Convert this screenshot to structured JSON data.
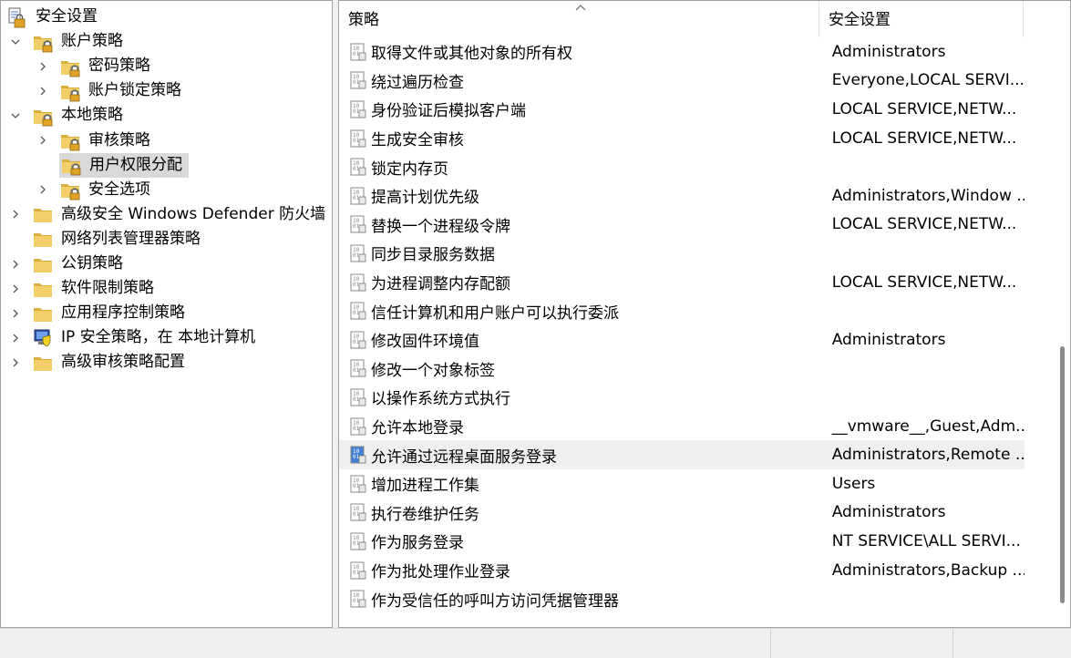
{
  "tree": {
    "items": [
      {
        "label": "安全设置",
        "level": 0,
        "expander": "none",
        "icon": "security-settings-icon"
      },
      {
        "label": "账户策略",
        "level": 1,
        "expander": "expanded",
        "icon": "folder-lock-icon"
      },
      {
        "label": "密码策略",
        "level": 2,
        "expander": "collapsed",
        "icon": "folder-lock-icon"
      },
      {
        "label": "账户锁定策略",
        "level": 2,
        "expander": "collapsed",
        "icon": "folder-lock-icon"
      },
      {
        "label": "本地策略",
        "level": 1,
        "expander": "expanded",
        "icon": "folder-lock-icon"
      },
      {
        "label": "审核策略",
        "level": 2,
        "expander": "collapsed",
        "icon": "folder-lock-icon"
      },
      {
        "label": "用户权限分配",
        "level": 2,
        "expander": "none",
        "icon": "folder-lock-icon",
        "selected": true
      },
      {
        "label": "安全选项",
        "level": 2,
        "expander": "collapsed",
        "icon": "folder-lock-icon"
      },
      {
        "label": "高级安全 Windows Defender 防火墙",
        "level": 1,
        "expander": "collapsed",
        "icon": "folder-icon"
      },
      {
        "label": "网络列表管理器策略",
        "level": 1,
        "expander": "none",
        "icon": "folder-icon"
      },
      {
        "label": "公钥策略",
        "level": 1,
        "expander": "collapsed",
        "icon": "folder-icon"
      },
      {
        "label": "软件限制策略",
        "level": 1,
        "expander": "collapsed",
        "icon": "folder-icon"
      },
      {
        "label": "应用程序控制策略",
        "level": 1,
        "expander": "collapsed",
        "icon": "folder-icon"
      },
      {
        "label": "IP 安全策略，在 本地计算机",
        "level": 1,
        "expander": "collapsed",
        "icon": "ip-security-icon"
      },
      {
        "label": "高级审核策略配置",
        "level": 1,
        "expander": "collapsed",
        "icon": "folder-icon"
      }
    ]
  },
  "list": {
    "columns": {
      "policy": "策略",
      "setting": "安全设置"
    },
    "rows": [
      {
        "policy": "取得文件或其他对象的所有权",
        "setting": "Administrators"
      },
      {
        "policy": "绕过遍历检查",
        "setting": "Everyone,LOCAL SERVI..."
      },
      {
        "policy": "身份验证后模拟客户端",
        "setting": "LOCAL SERVICE,NETW..."
      },
      {
        "policy": "生成安全审核",
        "setting": "LOCAL SERVICE,NETW..."
      },
      {
        "policy": "锁定内存页",
        "setting": ""
      },
      {
        "policy": "提高计划优先级",
        "setting": "Administrators,Window ..."
      },
      {
        "policy": "替换一个进程级令牌",
        "setting": "LOCAL SERVICE,NETW..."
      },
      {
        "policy": "同步目录服务数据",
        "setting": ""
      },
      {
        "policy": "为进程调整内存配额",
        "setting": "LOCAL SERVICE,NETW..."
      },
      {
        "policy": "信任计算机和用户账户可以执行委派",
        "setting": ""
      },
      {
        "policy": "修改固件环境值",
        "setting": "Administrators"
      },
      {
        "policy": "修改一个对象标签",
        "setting": ""
      },
      {
        "policy": "以操作系统方式执行",
        "setting": ""
      },
      {
        "policy": "允许本地登录",
        "setting": "__vmware__,Guest,Adm..."
      },
      {
        "policy": "允许通过远程桌面服务登录",
        "setting": "Administrators,Remote ...",
        "selected": true
      },
      {
        "policy": "增加进程工作集",
        "setting": "Users"
      },
      {
        "policy": "执行卷维护任务",
        "setting": "Administrators"
      },
      {
        "policy": "作为服务登录",
        "setting": "NT SERVICE\\ALL SERVI..."
      },
      {
        "policy": "作为批处理作业登录",
        "setting": "Administrators,Backup ..."
      },
      {
        "policy": "作为受信任的呼叫方访问凭据管理器",
        "setting": ""
      }
    ]
  },
  "colors": {
    "selected_tree": "#d9d9d9",
    "selected_row": "#efefef",
    "folder": "#e8c15a"
  }
}
